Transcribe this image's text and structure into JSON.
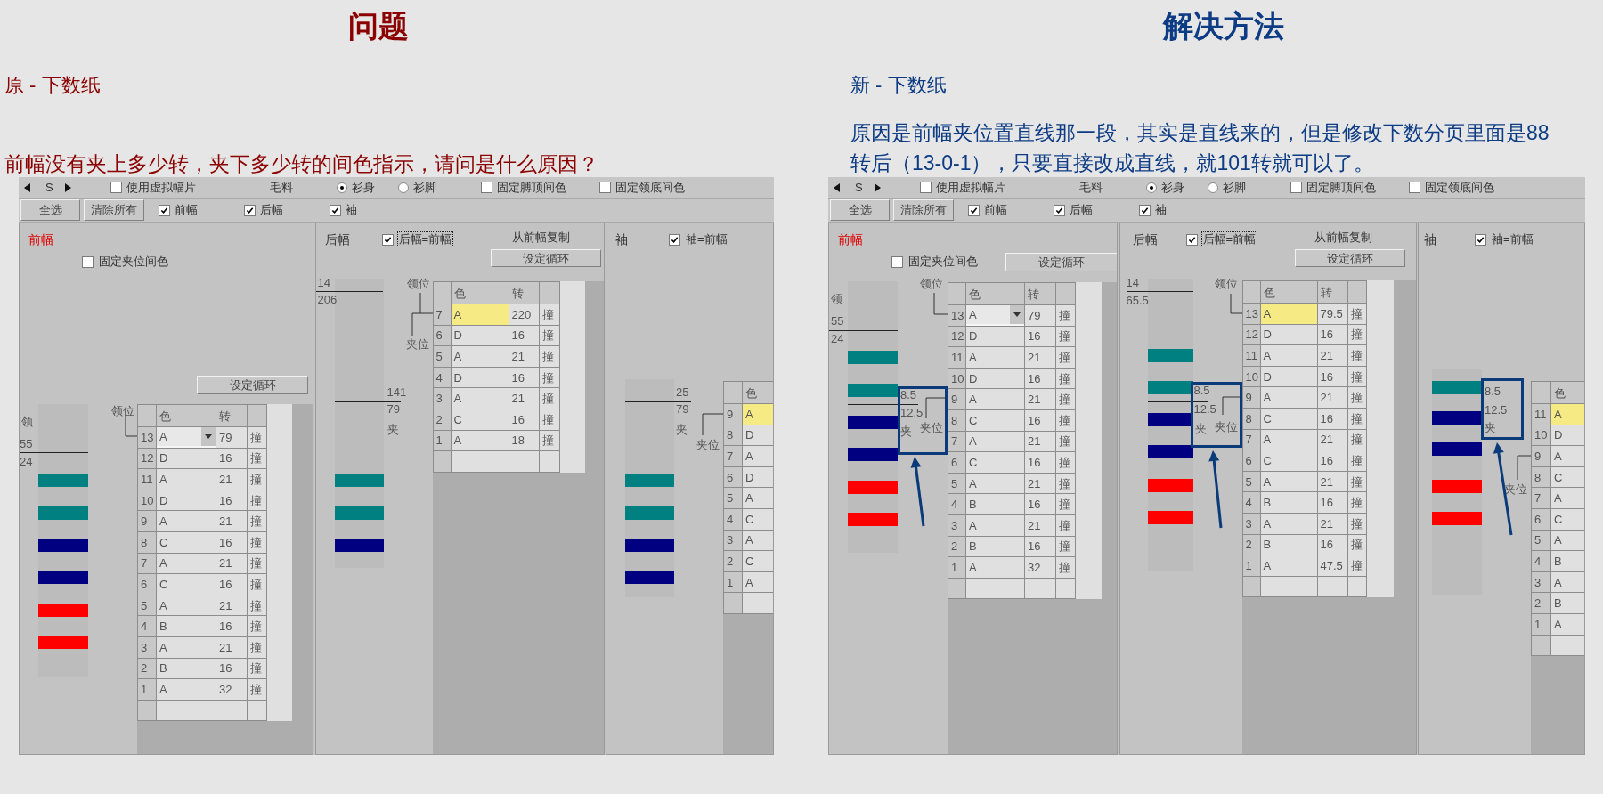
{
  "problem": {
    "heading": "问题",
    "subtitle": "原 - 下数纸",
    "text": "前幅没有夹上多少转，夹下多少转的间色指示，请问是什么原因？",
    "window": {
      "toolbar": {
        "size": "S",
        "virtual": {
          "label": "使用虚拟幅片",
          "checked": false
        },
        "material": "毛料",
        "radios": [
          {
            "label": "衫身",
            "selected": true
          },
          {
            "label": "衫脚",
            "selected": false
          }
        ],
        "options": [
          {
            "label": "固定膊顶间色",
            "checked": false
          },
          {
            "label": "固定领底间色",
            "checked": false
          }
        ],
        "buttons": [
          "全选",
          "清除所有"
        ],
        "parts": [
          {
            "label": "前幅",
            "checked": true
          },
          {
            "label": "后幅",
            "checked": true
          },
          {
            "label": "袖",
            "checked": true
          }
        ]
      },
      "panels": [
        {
          "title": "前幅",
          "selected": true,
          "option": {
            "label": "固定夹位间色",
            "checked": false,
            "focused": false
          },
          "button": "设定循环",
          "gauge": {
            "labels": [
              "领",
              "55",
              "24"
            ],
            "bars": [
              {
                "color": "#008080"
              },
              {
                "color": "#008080"
              },
              {
                "color": "#000080"
              },
              {
                "color": "#000080"
              },
              {
                "color": "#ff0000"
              },
              {
                "color": "#ff0000"
              }
            ]
          },
          "markers": [
            "领位"
          ],
          "columns": [
            "色",
            "转"
          ],
          "rows": [
            {
              "no": "13",
              "code": "A",
              "turns": "79",
              "action": "撞",
              "selected": false,
              "kind": "dropdown"
            },
            {
              "no": "12",
              "code": "D",
              "turns": "16",
              "action": "撞",
              "selected": false,
              "kind": "text"
            },
            {
              "no": "11",
              "code": "A",
              "turns": "21",
              "action": "撞",
              "selected": false,
              "kind": "text"
            },
            {
              "no": "10",
              "code": "D",
              "turns": "16",
              "action": "撞",
              "selected": false,
              "kind": "text"
            },
            {
              "no": "9",
              "code": "A",
              "turns": "21",
              "action": "撞",
              "selected": false,
              "kind": "text"
            },
            {
              "no": "8",
              "code": "C",
              "turns": "16",
              "action": "撞",
              "selected": false,
              "kind": "text"
            },
            {
              "no": "7",
              "code": "A",
              "turns": "21",
              "action": "撞",
              "selected": false,
              "kind": "text"
            },
            {
              "no": "6",
              "code": "C",
              "turns": "16",
              "action": "撞",
              "selected": false,
              "kind": "text"
            },
            {
              "no": "5",
              "code": "A",
              "turns": "21",
              "action": "撞",
              "selected": false,
              "kind": "text"
            },
            {
              "no": "4",
              "code": "B",
              "turns": "16",
              "action": "撞",
              "selected": false,
              "kind": "text"
            },
            {
              "no": "3",
              "code": "A",
              "turns": "21",
              "action": "撞",
              "selected": false,
              "kind": "text"
            },
            {
              "no": "2",
              "code": "B",
              "turns": "16",
              "action": "撞",
              "selected": false,
              "kind": "text"
            },
            {
              "no": "1",
              "code": "A",
              "turns": "32",
              "action": "撞",
              "selected": false,
              "kind": "text"
            }
          ]
        },
        {
          "title": "后幅",
          "selected": false,
          "option": {
            "label": "后幅=前幅",
            "checked": true,
            "focused": true
          },
          "copy_label": "从前幅复制",
          "button": "设定循环",
          "gauge": {
            "labels": [
              "14",
              "206",
              "141",
              "79",
              "夹"
            ],
            "bars": [
              {
                "color": "#008080"
              },
              {
                "color": "#008080"
              },
              {
                "color": "#000080"
              }
            ]
          },
          "markers": [
            "领位",
            "夹位"
          ],
          "columns": [
            "色",
            "转"
          ],
          "rows": [
            {
              "no": "7",
              "code": "A",
              "turns": "220",
              "action": "撞",
              "selected": true,
              "kind": "text"
            },
            {
              "no": "6",
              "code": "D",
              "turns": "16",
              "action": "撞",
              "selected": false,
              "kind": "text"
            },
            {
              "no": "5",
              "code": "A",
              "turns": "21",
              "action": "撞",
              "selected": false,
              "kind": "text"
            },
            {
              "no": "4",
              "code": "D",
              "turns": "16",
              "action": "撞",
              "selected": false,
              "kind": "text"
            },
            {
              "no": "3",
              "code": "A",
              "turns": "21",
              "action": "撞",
              "selected": false,
              "kind": "text"
            },
            {
              "no": "2",
              "code": "C",
              "turns": "16",
              "action": "撞",
              "selected": false,
              "kind": "text"
            },
            {
              "no": "1",
              "code": "A",
              "turns": "18",
              "action": "撞",
              "selected": false,
              "kind": "text"
            }
          ]
        },
        {
          "title": "袖",
          "selected": false,
          "option": {
            "label": "袖=前幅",
            "checked": true,
            "focused": false
          },
          "gauge": {
            "labels": [
              "25",
              "79",
              "夹"
            ],
            "bars": [
              {
                "color": "#008080"
              },
              {
                "color": "#008080"
              },
              {
                "color": "#000080"
              },
              {
                "color": "#000080"
              }
            ]
          },
          "markers": [
            "夹位"
          ],
          "columns": [
            "色"
          ],
          "rows": [
            {
              "no": "9",
              "code": "A",
              "selected": true,
              "kind": "text"
            },
            {
              "no": "8",
              "code": "D",
              "selected": false,
              "kind": "text"
            },
            {
              "no": "7",
              "code": "A",
              "selected": false,
              "kind": "text"
            },
            {
              "no": "6",
              "code": "D",
              "selected": false,
              "kind": "text"
            },
            {
              "no": "5",
              "code": "A",
              "selected": false,
              "kind": "text"
            },
            {
              "no": "4",
              "code": "C",
              "selected": false,
              "kind": "text"
            },
            {
              "no": "3",
              "code": "A",
              "selected": false,
              "kind": "text"
            },
            {
              "no": "2",
              "code": "C",
              "selected": false,
              "kind": "text"
            },
            {
              "no": "1",
              "code": "A",
              "selected": false,
              "kind": "text"
            }
          ]
        }
      ]
    }
  },
  "solution": {
    "heading": "解决方法",
    "subtitle": "新 - 下数纸",
    "text": "原因是前幅夹位置直线那一段，其实是直线来的，但是修改下数分页里面是88转后（13-0-1），只要直接改成直线，就101转就可以了。",
    "window": {
      "toolbar": {
        "size": "S",
        "virtual": {
          "label": "使用虚拟幅片",
          "checked": false
        },
        "material": "毛料",
        "radios": [
          {
            "label": "衫身",
            "selected": true
          },
          {
            "label": "衫脚",
            "selected": false
          }
        ],
        "options": [
          {
            "label": "固定膊顶间色",
            "checked": false
          },
          {
            "label": "固定领底间色",
            "checked": false
          }
        ],
        "buttons": [
          "全选",
          "清除所有"
        ],
        "parts": [
          {
            "label": "前幅",
            "checked": true
          },
          {
            "label": "后幅",
            "checked": true
          },
          {
            "label": "袖",
            "checked": true
          }
        ]
      },
      "panels": [
        {
          "title": "前幅",
          "selected": true,
          "option": {
            "label": "固定夹位间色",
            "checked": false,
            "focused": false
          },
          "button": "设定循环",
          "gauge": {
            "labels": [
              "领",
              "55",
              "24"
            ],
            "bars": [
              {
                "color": "#008080"
              },
              {
                "color": "#008080"
              },
              {
                "color": "#000080"
              },
              {
                "color": "#000080"
              },
              {
                "color": "#ff0000"
              },
              {
                "color": "#ff0000"
              }
            ]
          },
          "markers": [
            "领位"
          ],
          "callout": {
            "labels": [
              "8.5",
              "12.5",
              "夹"
            ],
            "marker": "夹位"
          },
          "columns": [
            "色",
            "转"
          ],
          "rows": [
            {
              "no": "13",
              "code": "A",
              "turns": "79",
              "action": "撞",
              "selected": false,
              "kind": "dropdown"
            },
            {
              "no": "12",
              "code": "D",
              "turns": "16",
              "action": "撞",
              "selected": false,
              "kind": "text"
            },
            {
              "no": "11",
              "code": "A",
              "turns": "21",
              "action": "撞",
              "selected": false,
              "kind": "text"
            },
            {
              "no": "10",
              "code": "D",
              "turns": "16",
              "action": "撞",
              "selected": false,
              "kind": "text"
            },
            {
              "no": "9",
              "code": "A",
              "turns": "21",
              "action": "撞",
              "selected": false,
              "kind": "text"
            },
            {
              "no": "8",
              "code": "C",
              "turns": "16",
              "action": "撞",
              "selected": false,
              "kind": "text"
            },
            {
              "no": "7",
              "code": "A",
              "turns": "21",
              "action": "撞",
              "selected": false,
              "kind": "text"
            },
            {
              "no": "6",
              "code": "C",
              "turns": "16",
              "action": "撞",
              "selected": false,
              "kind": "text"
            },
            {
              "no": "5",
              "code": "A",
              "turns": "21",
              "action": "撞",
              "selected": false,
              "kind": "text"
            },
            {
              "no": "4",
              "code": "B",
              "turns": "16",
              "action": "撞",
              "selected": false,
              "kind": "text"
            },
            {
              "no": "3",
              "code": "A",
              "turns": "21",
              "action": "撞",
              "selected": false,
              "kind": "text"
            },
            {
              "no": "2",
              "code": "B",
              "turns": "16",
              "action": "撞",
              "selected": false,
              "kind": "text"
            },
            {
              "no": "1",
              "code": "A",
              "turns": "32",
              "action": "撞",
              "selected": false,
              "kind": "text"
            }
          ]
        },
        {
          "title": "后幅",
          "selected": false,
          "option": {
            "label": "后幅=前幅",
            "checked": true,
            "focused": true
          },
          "copy_label": "从前幅复制",
          "button": "设定循环",
          "gauge": {
            "labels": [
              "14",
              "65.5"
            ],
            "bars": [
              {
                "color": "#008080"
              },
              {
                "color": "#008080"
              },
              {
                "color": "#000080"
              },
              {
                "color": "#000080"
              },
              {
                "color": "#ff0000"
              },
              {
                "color": "#ff0000"
              }
            ]
          },
          "markers": [
            "领位"
          ],
          "callout": {
            "labels": [
              "8.5",
              "12.5",
              "夹"
            ],
            "marker": "夹位"
          },
          "columns": [
            "色",
            "转"
          ],
          "rows": [
            {
              "no": "13",
              "code": "A",
              "turns": "79.5",
              "action": "撞",
              "selected": true,
              "kind": "text"
            },
            {
              "no": "12",
              "code": "D",
              "turns": "16",
              "action": "撞",
              "selected": false,
              "kind": "text"
            },
            {
              "no": "11",
              "code": "A",
              "turns": "21",
              "action": "撞",
              "selected": false,
              "kind": "text"
            },
            {
              "no": "10",
              "code": "D",
              "turns": "16",
              "action": "撞",
              "selected": false,
              "kind": "text"
            },
            {
              "no": "9",
              "code": "A",
              "turns": "21",
              "action": "撞",
              "selected": false,
              "kind": "text"
            },
            {
              "no": "8",
              "code": "C",
              "turns": "16",
              "action": "撞",
              "selected": false,
              "kind": "text"
            },
            {
              "no": "7",
              "code": "A",
              "turns": "21",
              "action": "撞",
              "selected": false,
              "kind": "text"
            },
            {
              "no": "6",
              "code": "C",
              "turns": "16",
              "action": "撞",
              "selected": false,
              "kind": "text"
            },
            {
              "no": "5",
              "code": "A",
              "turns": "21",
              "action": "撞",
              "selected": false,
              "kind": "text"
            },
            {
              "no": "4",
              "code": "B",
              "turns": "16",
              "action": "撞",
              "selected": false,
              "kind": "text"
            },
            {
              "no": "3",
              "code": "A",
              "turns": "21",
              "action": "撞",
              "selected": false,
              "kind": "text"
            },
            {
              "no": "2",
              "code": "B",
              "turns": "16",
              "action": "撞",
              "selected": false,
              "kind": "text"
            },
            {
              "no": "1",
              "code": "A",
              "turns": "47.5",
              "action": "撞",
              "selected": false,
              "kind": "text"
            }
          ]
        },
        {
          "title": "袖",
          "selected": false,
          "option": {
            "label": "袖=前幅",
            "checked": true,
            "focused": false
          },
          "gauge": {
            "bars": [
              {
                "color": "#008080"
              },
              {
                "color": "#000080"
              },
              {
                "color": "#000080"
              },
              {
                "color": "#ff0000"
              },
              {
                "color": "#ff0000"
              }
            ]
          },
          "markers": [
            "夹位"
          ],
          "callout": {
            "labels": [
              "8.5",
              "12.5",
              "夹"
            ]
          },
          "columns": [
            "色"
          ],
          "rows": [
            {
              "no": "11",
              "code": "A",
              "selected": true,
              "kind": "text"
            },
            {
              "no": "10",
              "code": "D",
              "selected": false,
              "kind": "text"
            },
            {
              "no": "9",
              "code": "A",
              "selected": false,
              "kind": "text"
            },
            {
              "no": "8",
              "code": "C",
              "selected": false,
              "kind": "text"
            },
            {
              "no": "7",
              "code": "A",
              "selected": false,
              "kind": "text"
            },
            {
              "no": "6",
              "code": "C",
              "selected": false,
              "kind": "text"
            },
            {
              "no": "5",
              "code": "A",
              "selected": false,
              "kind": "text"
            },
            {
              "no": "4",
              "code": "B",
              "selected": false,
              "kind": "text"
            },
            {
              "no": "3",
              "code": "A",
              "selected": false,
              "kind": "text"
            },
            {
              "no": "2",
              "code": "B",
              "selected": false,
              "kind": "text"
            },
            {
              "no": "1",
              "code": "A",
              "selected": false,
              "kind": "text"
            }
          ]
        }
      ]
    }
  }
}
